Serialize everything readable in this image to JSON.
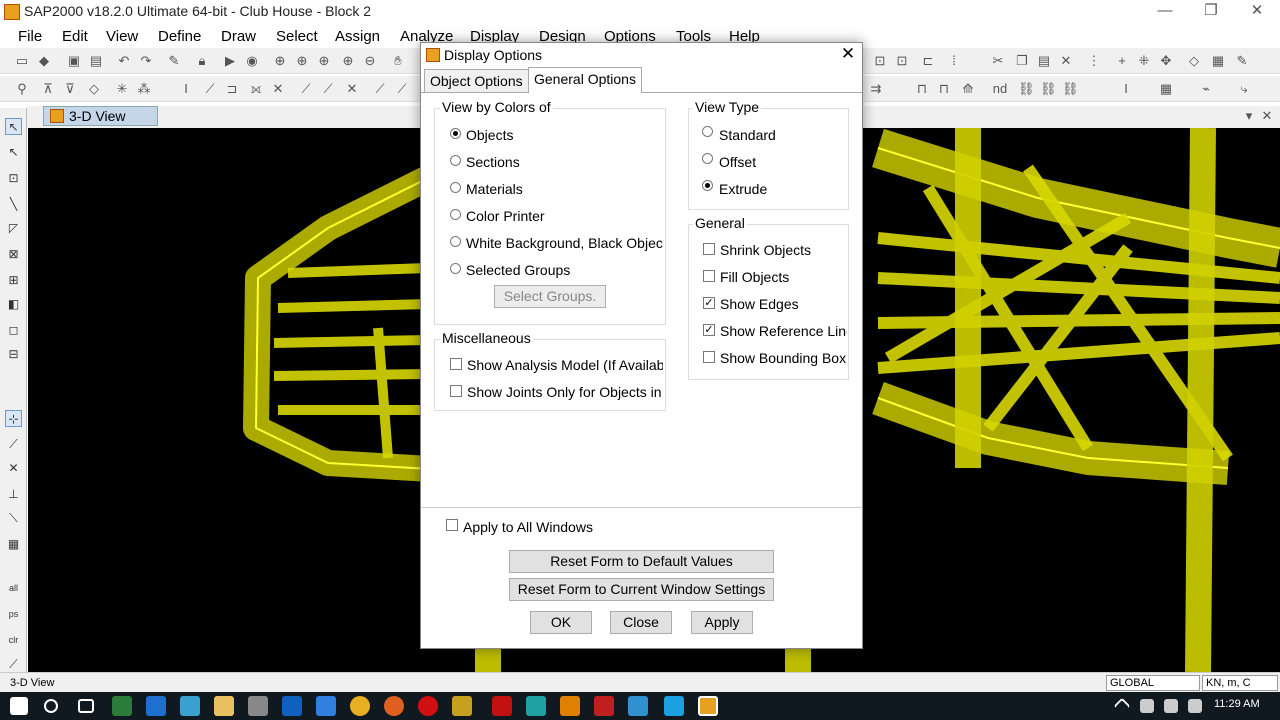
{
  "window": {
    "title": "SAP2000 v18.2.0 Ultimate 64-bit - Club House - Block 2",
    "minimize": "—",
    "restore": "❐",
    "close": "✕"
  },
  "menu": [
    "File",
    "Edit",
    "View",
    "Define",
    "Draw",
    "Select",
    "Assign",
    "Analyze",
    "Display",
    "Design",
    "Options",
    "Tools",
    "Help"
  ],
  "view_tab": {
    "label": "3-D View"
  },
  "status": {
    "text": "3-D View",
    "coord_system": "GLOBAL",
    "units": "KN, m, C"
  },
  "clock": "11:29 AM",
  "colors": {
    "structure": "#e6e600",
    "viewport_bg": "#000000",
    "tab_active": "#c6d6ea"
  },
  "dialog": {
    "title": "Display Options",
    "close": "✕",
    "tabs": [
      "Object Options",
      "General Options"
    ],
    "active_tab": "General Options",
    "view_by_colors": {
      "title": "View by Colors of",
      "options": [
        "Objects",
        "Sections",
        "Materials",
        "Color Printer",
        "White Background, Black Object",
        "Selected Groups"
      ],
      "selected": "Objects",
      "select_groups_button": "Select Groups."
    },
    "miscellaneous": {
      "title": "Miscellaneous",
      "options": [
        {
          "label": "Show Analysis Model (If Available)",
          "checked": false
        },
        {
          "label": "Show Joints Only for Objects in",
          "checked": false
        }
      ]
    },
    "view_type": {
      "title": "View Type",
      "options": [
        "Standard",
        "Offset",
        "Extrude"
      ],
      "selected": "Extrude"
    },
    "general": {
      "title": "General",
      "options": [
        {
          "label": "Shrink Objects",
          "checked": false
        },
        {
          "label": "Fill Objects",
          "checked": false
        },
        {
          "label": "Show Edges",
          "checked": true
        },
        {
          "label": "Show Reference Lines",
          "checked": true
        },
        {
          "label": "Show Bounding Box",
          "checked": false
        }
      ]
    },
    "apply_all": {
      "label": "Apply to All Windows",
      "checked": false
    },
    "buttons": {
      "reset_default": "Reset Form to Default Values",
      "reset_current": "Reset Form to Current Window Settings",
      "ok": "OK",
      "close": "Close",
      "apply": "Apply"
    }
  }
}
